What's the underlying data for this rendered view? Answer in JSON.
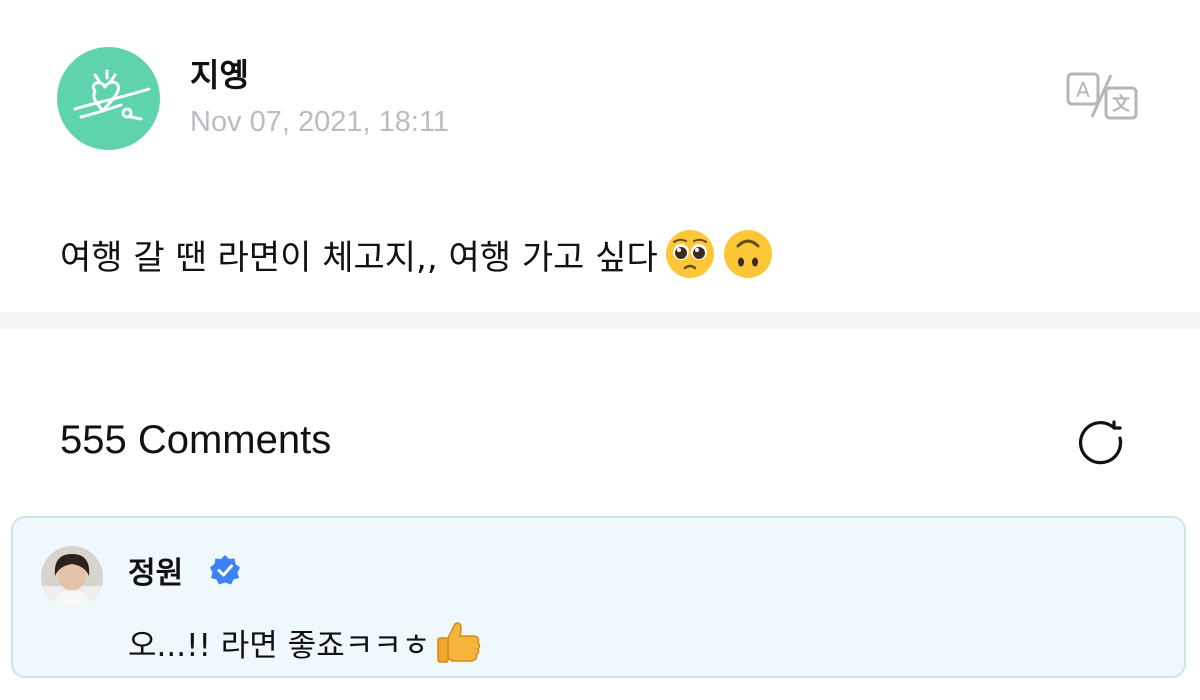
{
  "post": {
    "author_name": "지옝",
    "timestamp": "Nov 07, 2021, 18:11",
    "text": "여행 갈 땐 라면이 체고지,, 여행 가고 싶다",
    "emojis": [
      "pleading-face-emoji",
      "upside-down-face-emoji"
    ],
    "actions": {
      "translate_icon": "translate-icon"
    }
  },
  "comments": {
    "count_label": "555 Comments",
    "refresh_icon": "refresh-icon",
    "items": [
      {
        "author_name": "정원",
        "verified": true,
        "text": "오...!! 라면 좋죠ㅋㅋㅎ",
        "emoji": "thumbs-up-emoji"
      }
    ]
  },
  "colors": {
    "avatar_bg": "#5ed3ae",
    "timestamp": "#b9bcc2",
    "divider": "#f4f5f8",
    "comment_bg": "#eef8fd",
    "comment_border": "#cfe3ee",
    "verified": "#3b82f6"
  }
}
